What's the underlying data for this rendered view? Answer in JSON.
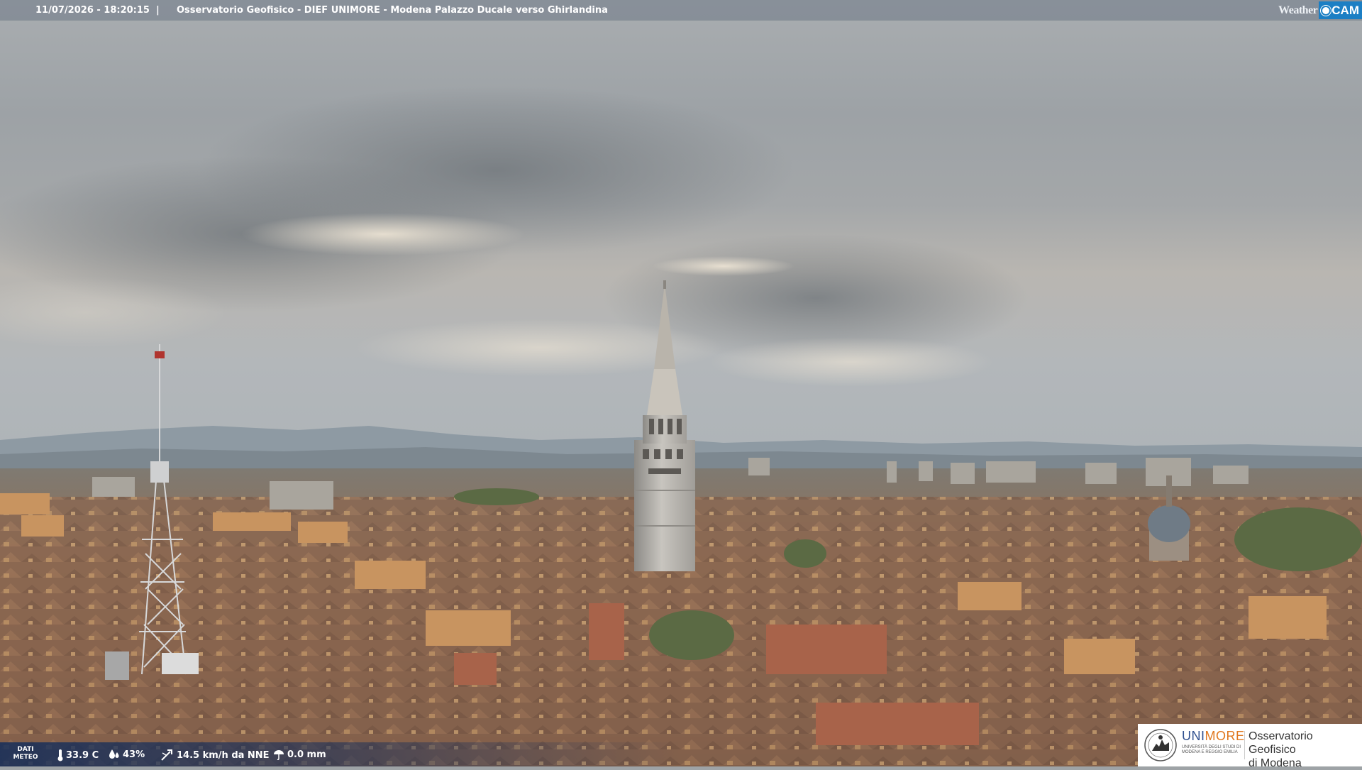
{
  "topbar": {
    "timestamp": "11/07/2026 - 18:20:15",
    "separator": "|",
    "title": "Osservatorio Geofisico - DIEF UNIMORE - Modena Palazzo Ducale verso Ghirlandina"
  },
  "webcam_logo": {
    "weather": "Weather",
    "cam": "CAM"
  },
  "meteo": {
    "label_line1": "DATI",
    "label_line2": "METEO",
    "temperature": "33.9 C",
    "humidity": "43%",
    "wind": "14.5 km/h da NNE",
    "rain": "0.0 mm"
  },
  "unimore": {
    "brand_uni": "UNI",
    "brand_more": "MORE",
    "subtitle": "UNIVERSITÀ DEGLI STUDI DI MODENA E REGGIO EMILIA",
    "observatory_line1": "Osservatorio Geofisico",
    "observatory_line2": "di Modena"
  },
  "colors": {
    "unimore_blue": "#2f4f8f",
    "unimore_orange": "#e0771d",
    "weathercam_blue": "#1c7fc4"
  },
  "icons": [
    "thermometer-icon",
    "humidity-icon",
    "wind-icon",
    "rain-gauge-icon"
  ]
}
